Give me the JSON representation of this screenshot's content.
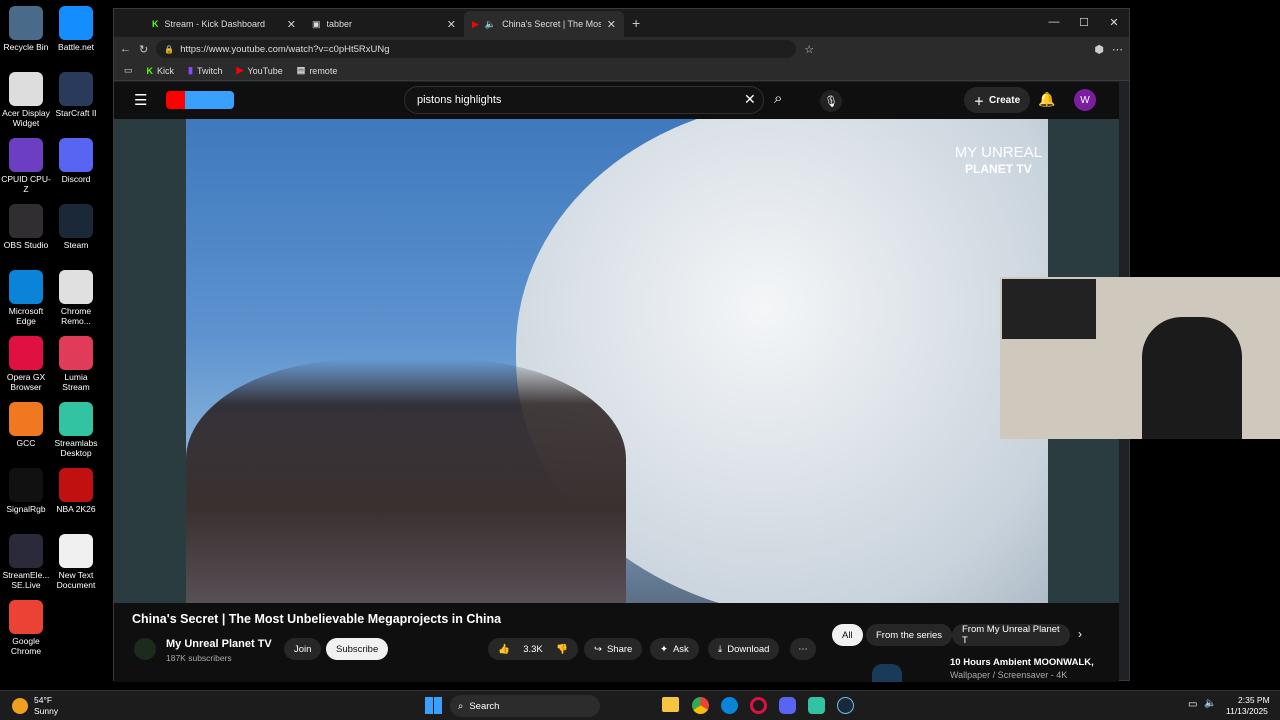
{
  "desktop_icons": [
    {
      "label": "Recycle Bin",
      "color": "#4a6a8a"
    },
    {
      "label": "Battle.net",
      "color": "#148eff"
    },
    {
      "label": "Acer Display Widget",
      "color": "#ddd"
    },
    {
      "label": "StarCraft II",
      "color": "#2a3a5a"
    },
    {
      "label": "CPUID CPU-Z",
      "color": "#6c3fc2"
    },
    {
      "label": "Discord",
      "color": "#5865f2"
    },
    {
      "label": "OBS Studio",
      "color": "#302e31"
    },
    {
      "label": "Steam",
      "color": "#1b2838"
    },
    {
      "label": "Microsoft Edge",
      "color": "#0a84d8"
    },
    {
      "label": "Chrome Remo...",
      "color": "#e0e0e0"
    },
    {
      "label": "Opera GX Browser",
      "color": "#e01040"
    },
    {
      "label": "Lumia Stream",
      "color": "#e03c5a"
    },
    {
      "label": "GCC",
      "color": "#f07820"
    },
    {
      "label": "Streamlabs Desktop",
      "color": "#31c3a2"
    },
    {
      "label": "SignalRgb",
      "color": "#111"
    },
    {
      "label": "NBA 2K26",
      "color": "#c01010"
    },
    {
      "label": "StreamEle... SE.Live",
      "color": "#2a2a3a"
    },
    {
      "label": "New Text Document",
      "color": "#f0f0f0"
    },
    {
      "label": "Google Chrome",
      "color": "#ea4335"
    }
  ],
  "tabs": [
    {
      "title": "Stream - Kick Dashboard"
    },
    {
      "title": "tabber"
    },
    {
      "title": "China's Secret | The Most Unbelievable"
    }
  ],
  "address": "https://www.youtube.com/watch?v=c0pHt5RxUNg",
  "bookmarks": [
    "Kick",
    "Twitch",
    "YouTube",
    "remote"
  ],
  "yt": {
    "search_value": "pistons highlights",
    "create_label": "Create",
    "avatar": "W",
    "watermark_line1": "MY UNREAL",
    "watermark_line2": "PLANET TV",
    "video_title": "China's Secret | The Most Unbelievable Megaprojects in China",
    "channel": "My Unreal Planet TV",
    "subscribers": "187K subscribers",
    "join": "Join",
    "subscribe": "Subscribe",
    "likes": "3.3K",
    "share": "Share",
    "ask": "Ask",
    "download": "Download",
    "chips": [
      "All",
      "From the series",
      "From My Unreal Planet T"
    ],
    "rec_title": "10 Hours Ambient MOONWALK,",
    "rec_sub": "Wallpaper / Screensaver - 4K"
  },
  "weather": {
    "temp": "54°F",
    "cond": "Sunny"
  },
  "taskbar": {
    "search": "Search",
    "time": "2:35 PM",
    "date": "11/13/2025"
  }
}
